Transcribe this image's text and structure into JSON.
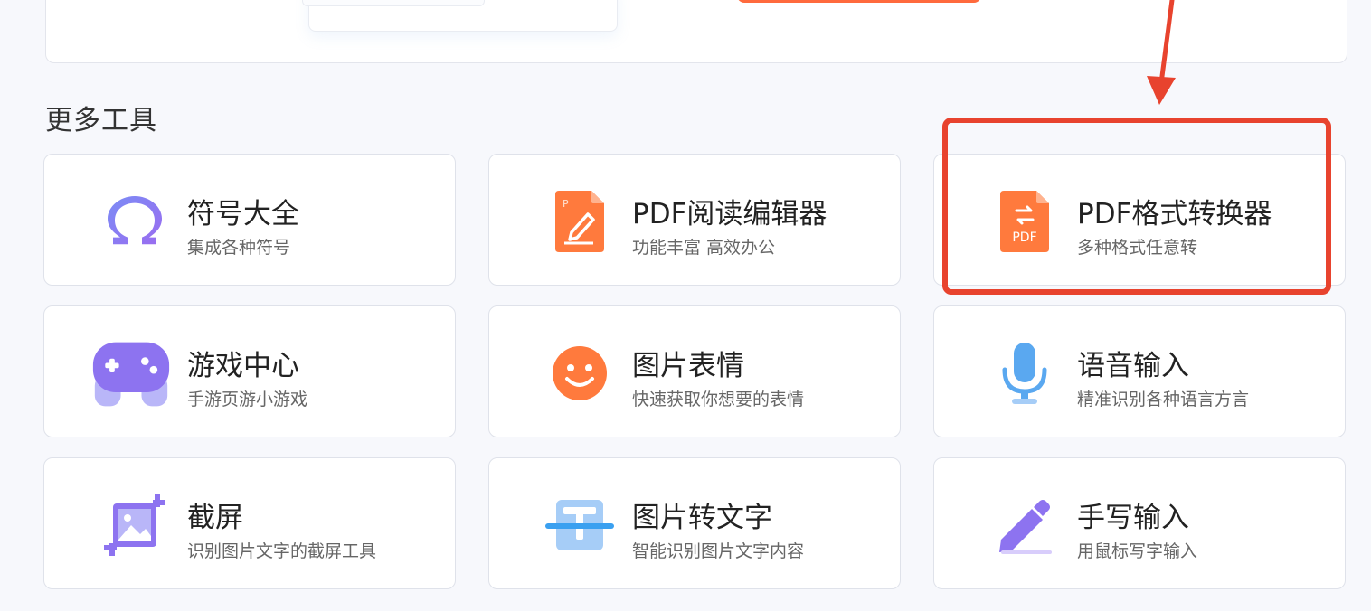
{
  "section": {
    "title": "更多工具"
  },
  "tools": [
    {
      "title": "符号大全",
      "subtitle": "集成各种符号",
      "icon": "omega-icon"
    },
    {
      "title": "PDF阅读编辑器",
      "subtitle": "功能丰富 高效办公",
      "icon": "pdf-edit-icon"
    },
    {
      "title": "PDF格式转换器",
      "subtitle": "多种格式任意转",
      "icon": "pdf-convert-icon",
      "icon_text": "PDF"
    },
    {
      "title": "游戏中心",
      "subtitle": "手游页游小游戏",
      "icon": "gamepad-icon"
    },
    {
      "title": "图片表情",
      "subtitle": "快速获取你想要的表情",
      "icon": "smiley-icon"
    },
    {
      "title": "语音输入",
      "subtitle": "精准识别各种语言方言",
      "icon": "microphone-icon"
    },
    {
      "title": "截屏",
      "subtitle": "识别图片文字的截屏工具",
      "icon": "screenshot-icon"
    },
    {
      "title": "图片转文字",
      "subtitle": "智能识别图片文字内容",
      "icon": "ocr-scan-icon"
    },
    {
      "title": "手写输入",
      "subtitle": "用鼠标写字输入",
      "icon": "pencil-icon"
    }
  ],
  "colors": {
    "annotation": "#e8432e",
    "orange": "#ff7a3d",
    "purple": "#8b6cf0",
    "blue": "#5aa8f0"
  }
}
